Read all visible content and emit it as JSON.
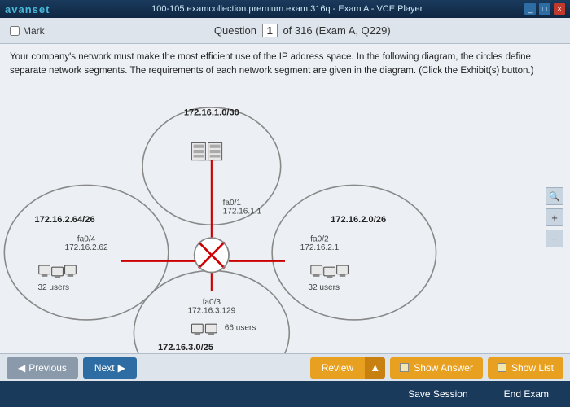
{
  "titleBar": {
    "logo": "avanset",
    "title": "100-105.examcollection.premium.exam.316q - Exam A - VCE Player",
    "winButtons": [
      "_",
      "□",
      "×"
    ]
  },
  "header": {
    "markLabel": "Mark",
    "questionLabel": "Question",
    "questionNum": "1",
    "totalQuestions": "316",
    "examName": "Exam A, Q229"
  },
  "questionText": "Your company's network must make the most efficient use of the IP address space. In the following diagram, the circles define separate network segments. The requirements of each network segment are given in the diagram. (Click the Exhibit(s) button.)",
  "network": {
    "topNet": {
      "subnet": "172.16.1.0/30",
      "interface": "fa0/1",
      "ip": "172.16.1.1"
    },
    "leftNet": {
      "subnet": "172.16.2.64/26",
      "interface": "fa0/4",
      "ip": "172.16.2.62",
      "users": "32 users"
    },
    "rightNet": {
      "subnet": "172.16.2.0/26",
      "interface": "fa0/2",
      "ip": "172.16.2.1",
      "users": "32 users"
    },
    "bottomNet": {
      "subnet": "172.16.3.0/25",
      "interface": "fa0/3",
      "ip": "172.16.3.129",
      "users": "66 users"
    }
  },
  "toolbar": {
    "prevLabel": "Previous",
    "nextLabel": "Next",
    "reviewLabel": "Review",
    "showAnswerLabel": "Show Answer",
    "showListLabel": "Show List",
    "saveSessionLabel": "Save Session",
    "endExamLabel": "End Exam"
  },
  "zoom": {
    "searchIcon": "🔍",
    "plusIcon": "+",
    "minusIcon": "−"
  }
}
